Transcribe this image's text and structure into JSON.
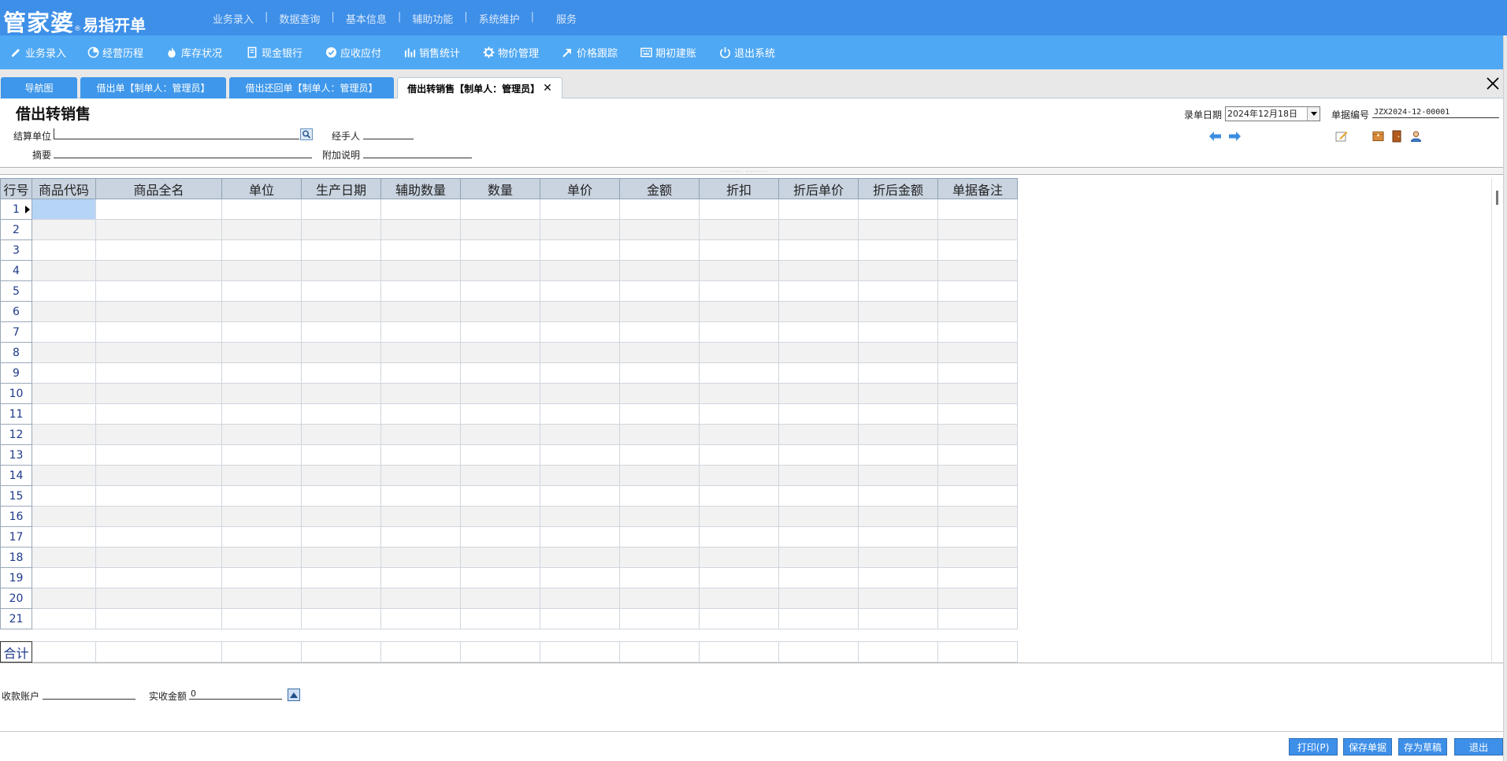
{
  "header": {
    "brand": "管家婆",
    "brand_reg": "®",
    "product": "易指开单",
    "menu": [
      "业务录入",
      "数据查询",
      "基本信息",
      "辅助功能",
      "系统维护",
      "服务"
    ],
    "separator": "|"
  },
  "toolbar": {
    "items": [
      {
        "label": "业务录入",
        "icon": "pen-icon"
      },
      {
        "label": "经营历程",
        "icon": "pie-chart-icon"
      },
      {
        "label": "库存状况",
        "icon": "flame-icon"
      },
      {
        "label": "现金银行",
        "icon": "book-icon"
      },
      {
        "label": "应收应付",
        "icon": "check-circle-icon"
      },
      {
        "label": "销售统计",
        "icon": "bar-chart-icon"
      },
      {
        "label": "物价管理",
        "icon": "gear-icon"
      },
      {
        "label": "价格跟踪",
        "icon": "arrow-up-right-icon"
      },
      {
        "label": "期初建账",
        "icon": "keyboard-icon"
      },
      {
        "label": "退出系统",
        "icon": "power-icon"
      }
    ]
  },
  "tabs": [
    {
      "label": "导航图",
      "active": false
    },
    {
      "label": "借出单【制单人：管理员】",
      "active": false
    },
    {
      "label": "借出还回单【制单人：管理员】",
      "active": false
    },
    {
      "label": "借出转销售【制单人：管理员】",
      "active": true,
      "close": "✕"
    }
  ],
  "form": {
    "title": "借出转销售",
    "settle_unit_label": "结算单位",
    "settle_unit_value": "",
    "handler_label": "经手人",
    "handler_value": "",
    "summary_label": "摘要",
    "summary_value": "",
    "extra_label": "附加说明",
    "extra_value": "",
    "date_label": "录单日期",
    "date_value": "2024年12月18日",
    "docno_label": "单据编号",
    "docno_value": "JZX2024-12-00001",
    "splitter_grip": "········· ·········"
  },
  "grid": {
    "columns": [
      "行号",
      "商品代码",
      "商品全名",
      "单位",
      "生产日期",
      "辅助数量",
      "数量",
      "单价",
      "金额",
      "折扣",
      "折后单价",
      "折后金额",
      "单据备注"
    ],
    "row_numbers": [
      "1",
      "2",
      "3",
      "4",
      "5",
      "6",
      "7",
      "8",
      "9",
      "10",
      "11",
      "12",
      "13",
      "14",
      "15",
      "16",
      "17",
      "18",
      "19",
      "20",
      "21"
    ],
    "total_label": "合计"
  },
  "bottom": {
    "account_label": "收款账户",
    "account_value": "",
    "received_label": "实收金额",
    "received_value": "0"
  },
  "buttons": {
    "print": "打印(P)",
    "save": "保存单据",
    "draft": "存为草稿",
    "exit": "退出"
  },
  "colors": {
    "header_bg": "#3d8fe8",
    "toolbar_bg": "#4fa8f3",
    "grid_header_bg": "#c9d4e0",
    "selected_cell": "#b6d4f5"
  }
}
